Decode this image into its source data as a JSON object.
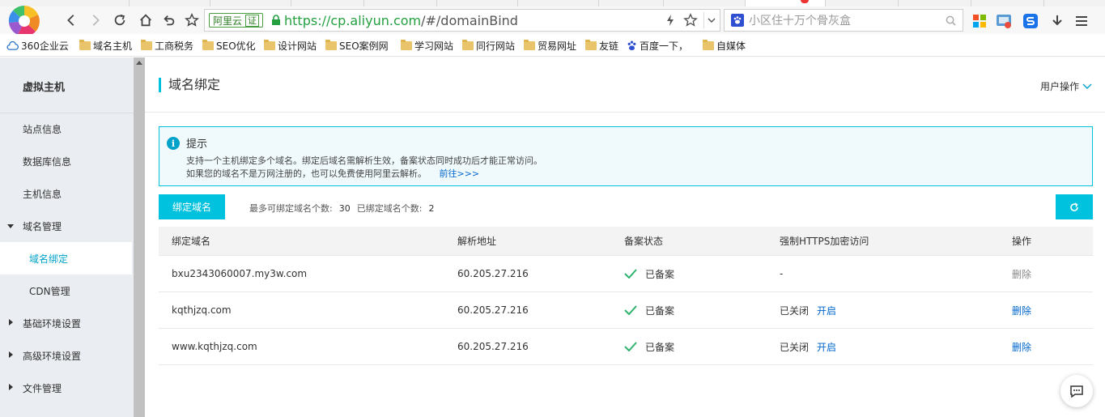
{
  "browser": {
    "address": {
      "cert_label": "阿里云",
      "cert_badge": "证",
      "url_host": "https://cp.aliyun.com",
      "url_path": "/#/domainBind"
    },
    "search": {
      "placeholder": "小区住十万个骨灰盒"
    },
    "bookmarks": [
      "360企业云",
      "域名主机",
      "工商税务",
      "SEO优化",
      "设计网站",
      "SEO案例网",
      "学习网站",
      "同行网站",
      "贸易网址",
      "友链",
      "百度一下，",
      "自媒体"
    ],
    "accent": "#24a040"
  },
  "sidebar": {
    "title": "虚拟主机",
    "items": [
      {
        "label": "站点信息"
      },
      {
        "label": "数据库信息"
      },
      {
        "label": "主机信息"
      },
      {
        "label": "域名管理",
        "expanded": true
      },
      {
        "label": "域名绑定",
        "active": true
      },
      {
        "label": "CDN管理"
      },
      {
        "label": "基础环境设置"
      },
      {
        "label": "高级环境设置"
      },
      {
        "label": "文件管理"
      }
    ]
  },
  "header": {
    "title": "域名绑定",
    "user_ops": "用户操作"
  },
  "notice": {
    "title": "提示",
    "line1": "支持一个主机绑定多个域名。绑定后域名需解析生效，备案状态同时成功后才能正常访问。",
    "line2": "如果您的域名不是万网注册的，也可以免费使用阿里云解析。",
    "link": "前往>>>"
  },
  "toolbar": {
    "bind_button": "绑定域名",
    "max_label": "最多可绑定域名个数:",
    "max_value": "30",
    "bound_label": "已绑定域名个数:",
    "bound_value": "2"
  },
  "table": {
    "headers": [
      "绑定域名",
      "解析地址",
      "备案状态",
      "强制HTTPS加密访问",
      "操作"
    ],
    "rows": [
      {
        "domain": "bxu2343060007.my3w.com",
        "ip": "60.205.27.216",
        "record": "已备案",
        "https_status": "-",
        "https_action": "",
        "op": "删除",
        "op_disabled": true
      },
      {
        "domain": "kqthjzq.com",
        "ip": "60.205.27.216",
        "record": "已备案",
        "https_status": "已关闭",
        "https_action": "开启",
        "op": "删除",
        "op_disabled": false
      },
      {
        "domain": "www.kqthjzq.com",
        "ip": "60.205.27.216",
        "record": "已备案",
        "https_status": "已关闭",
        "https_action": "开启",
        "op": "删除",
        "op_disabled": false
      }
    ]
  },
  "colors": {
    "primary": "#00c1de",
    "link": "#0066cc",
    "check": "#2fb36e"
  }
}
